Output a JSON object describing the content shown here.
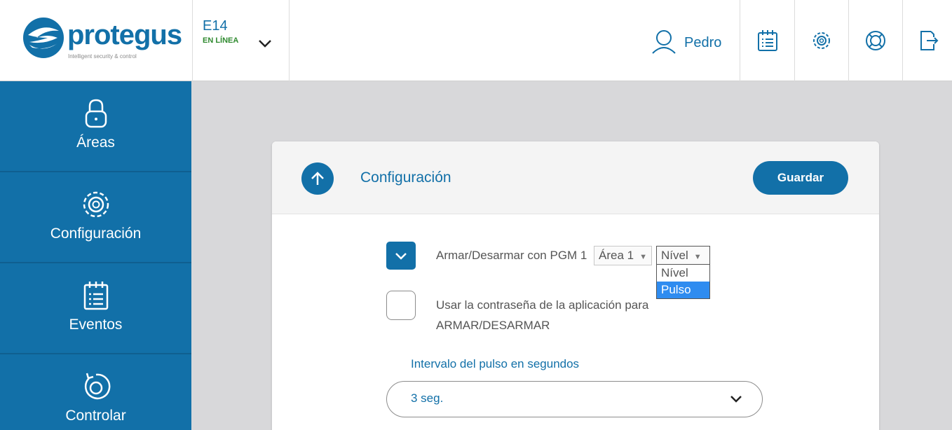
{
  "brand": {
    "name": "protegus",
    "tagline": "Intelligent security & control",
    "color": "#1270a8"
  },
  "device": {
    "name": "E14",
    "status": "EN LÍNEA",
    "status_color": "#2f8a2f"
  },
  "user": {
    "name": "Pedro"
  },
  "header_buttons": [
    {
      "icon": "calendar-list-icon"
    },
    {
      "icon": "gear-icon"
    },
    {
      "icon": "lifebuoy-icon"
    },
    {
      "icon": "logout-icon"
    }
  ],
  "sidebar": {
    "items": [
      {
        "label": "Áreas",
        "icon": "padlock-icon"
      },
      {
        "label": "Configuración",
        "icon": "gear-icon"
      },
      {
        "label": "Eventos",
        "icon": "calendar-list-icon"
      },
      {
        "label": "Controlar",
        "icon": "rotate-dial-icon"
      }
    ]
  },
  "card": {
    "title": "Configuración",
    "save_label": "Guardar",
    "pgm_label": "Armar/Desarmar con PGM 1",
    "area_select_value": "Área 1",
    "mode_select_value": "Nível",
    "mode_options": [
      "Nível",
      "Pulso"
    ],
    "mode_highlighted": "Pulso",
    "pgm_checked": true,
    "password_label_line1": "Usar la contraseña de la aplicación para",
    "password_label_line2": "ARMAR/DESARMAR",
    "password_checked": false,
    "interval_label": "Intervalo del pulso en segundos",
    "interval_value": "3 seg."
  }
}
